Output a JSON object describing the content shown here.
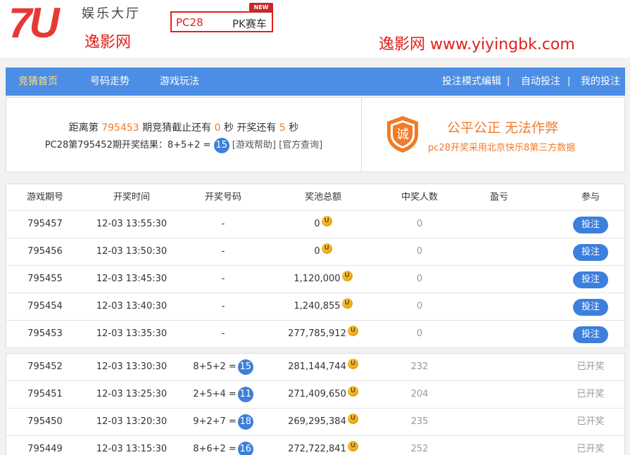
{
  "header": {
    "logo_text": "7U",
    "logo_subtitle": "娱乐大厅",
    "watermark_left": "逸影网",
    "watermark_right": "逸影网 www.yiyingbk.com",
    "games": [
      "PC28",
      "PK赛车"
    ],
    "new_badge": "NEW"
  },
  "nav": {
    "left": [
      "竞猜首页",
      "号码走势",
      "游戏玩法"
    ],
    "right": [
      "投注模式编辑",
      "自动投注",
      "我的投注"
    ],
    "separator": "|"
  },
  "info": {
    "countdown": {
      "prefix": "距离第",
      "period": "795453",
      "mid1": "期竞猜截止还有",
      "close_seconds": "0",
      "mid2": "秒 开奖还有",
      "draw_seconds": "5",
      "suffix": "秒"
    },
    "result": {
      "text": "PC28第795452期开奖结果：8+5+2 =",
      "value": "15",
      "help_link": "[游戏帮助]",
      "official_link": "[官方查询]"
    },
    "badge_char": "诚",
    "fair_title": "公平公正 无法作弊",
    "fair_subtitle": "pc28开奖采用北京快乐8第三方数据"
  },
  "table": {
    "headers": [
      "游戏期号",
      "开奖时间",
      "开奖号码",
      "奖池总额",
      "中奖人数",
      "盈亏",
      "参与"
    ],
    "pending": [
      {
        "id": "795457",
        "time": "12-03 13:55:30",
        "code": "-",
        "pool": "0",
        "winners": "0",
        "action": "投注"
      },
      {
        "id": "795456",
        "time": "12-03 13:50:30",
        "code": "-",
        "pool": "0",
        "winners": "0",
        "action": "投注"
      },
      {
        "id": "795455",
        "time": "12-03 13:45:30",
        "code": "-",
        "pool": "1,120,000",
        "winners": "0",
        "action": "投注"
      },
      {
        "id": "795454",
        "time": "12-03 13:40:30",
        "code": "-",
        "pool": "1,240,855",
        "winners": "0",
        "action": "投注"
      },
      {
        "id": "795453",
        "time": "12-03 13:35:30",
        "code": "-",
        "pool": "277,785,912",
        "winners": "0",
        "action": "投注"
      }
    ],
    "finished": [
      {
        "id": "795452",
        "time": "12-03 13:30:30",
        "code": "8+5+2 =",
        "result": "15",
        "pool": "281,144,744",
        "winners": "232",
        "action": "已开奖"
      },
      {
        "id": "795451",
        "time": "12-03 13:25:30",
        "code": "2+5+4 =",
        "result": "11",
        "pool": "271,409,650",
        "winners": "204",
        "action": "已开奖"
      },
      {
        "id": "795450",
        "time": "12-03 13:20:30",
        "code": "9+2+7 =",
        "result": "18",
        "pool": "269,295,384",
        "winners": "235",
        "action": "已开奖"
      },
      {
        "id": "795449",
        "time": "12-03 13:15:30",
        "code": "8+6+2 =",
        "result": "16",
        "pool": "272,722,841",
        "winners": "252",
        "action": "已开奖"
      }
    ],
    "coin_glyph": "U"
  },
  "colors": {
    "brand_red": "#e0211b",
    "nav_blue": "#4c8ee5",
    "accent_orange": "#f07c28",
    "ball_blue": "#3d7fdc"
  }
}
